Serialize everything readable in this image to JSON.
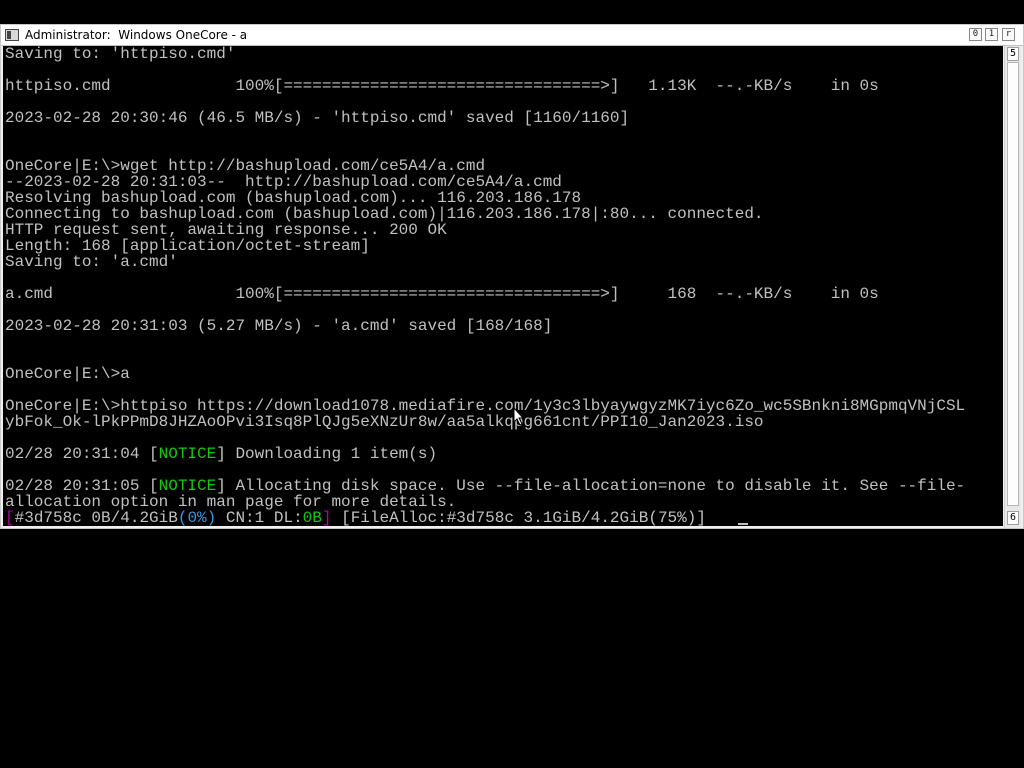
{
  "window": {
    "title": "Administrator:  Windows OneCore - a",
    "buttons": {
      "minimize": "0",
      "maximize": "1",
      "restore": "r"
    }
  },
  "scrollbar": {
    "up": "5",
    "down": "6"
  },
  "console": {
    "lines": [
      "Saving to: 'httpiso.cmd'",
      "",
      "httpiso.cmd             100%[=================================>]   1.13K  --.-KB/s    in 0s",
      "",
      "2023-02-28 20:30:46 (46.5 MB/s) - 'httpiso.cmd' saved [1160/1160]",
      "",
      "",
      "OneCore|E:\\>wget http://bashupload.com/ce5A4/a.cmd",
      "--2023-02-28 20:31:03--  http://bashupload.com/ce5A4/a.cmd",
      "Resolving bashupload.com (bashupload.com)... 116.203.186.178",
      "Connecting to bashupload.com (bashupload.com)|116.203.186.178|:80... connected.",
      "HTTP request sent, awaiting response... 200 OK",
      "Length: 168 [application/octet-stream]",
      "Saving to: 'a.cmd'",
      "",
      "a.cmd                   100%[=================================>]     168  --.-KB/s    in 0s",
      "",
      "2023-02-28 20:31:03 (5.27 MB/s) - 'a.cmd' saved [168/168]",
      "",
      "",
      "OneCore|E:\\>a",
      "",
      "OneCore|E:\\>httpiso https://download1078.mediafire.com/1y3c3lbyaywgyzMK7iyc6Zo_wc5SBnkni8MGpmqVNjCSL",
      "ybFok_Ok-lPkPPmD8JHZAoOPvi3Isq8PlQJg5eXNzUr8w/aa5alkqpg661cnt/PPI10_Jan2023.iso",
      "",
      "02/28 20:31:04 [",
      "",
      "02/28 20:31:05 [",
      "allocation option in man page for more details."
    ],
    "notice_1": {
      "prefix": "02/28 20:31:04 [",
      "tag": "NOTICE",
      "suffix": "] Downloading 1 item(s)"
    },
    "notice_2": {
      "prefix": "02/28 20:31:05 [",
      "tag": "NOTICE",
      "suffix": "] Allocating disk space. Use --file-allocation=none to disable it. See --file-"
    },
    "status": {
      "open": "[",
      "id": "#3d758c",
      "size": " 0B/4.2GiB",
      "pct": "(0%)",
      "cn": " CN:1 DL:",
      "dl": "0B",
      "close": "]",
      "alloc": " [FileAlloc:#3d758c 3.1GiB/4.2GiB(75%)]"
    }
  },
  "colors": {
    "background": "#000000",
    "text": "#c0c0c0",
    "notice": "#16c60c",
    "bracket": "#b4009e",
    "percent": "#3a96dd"
  }
}
